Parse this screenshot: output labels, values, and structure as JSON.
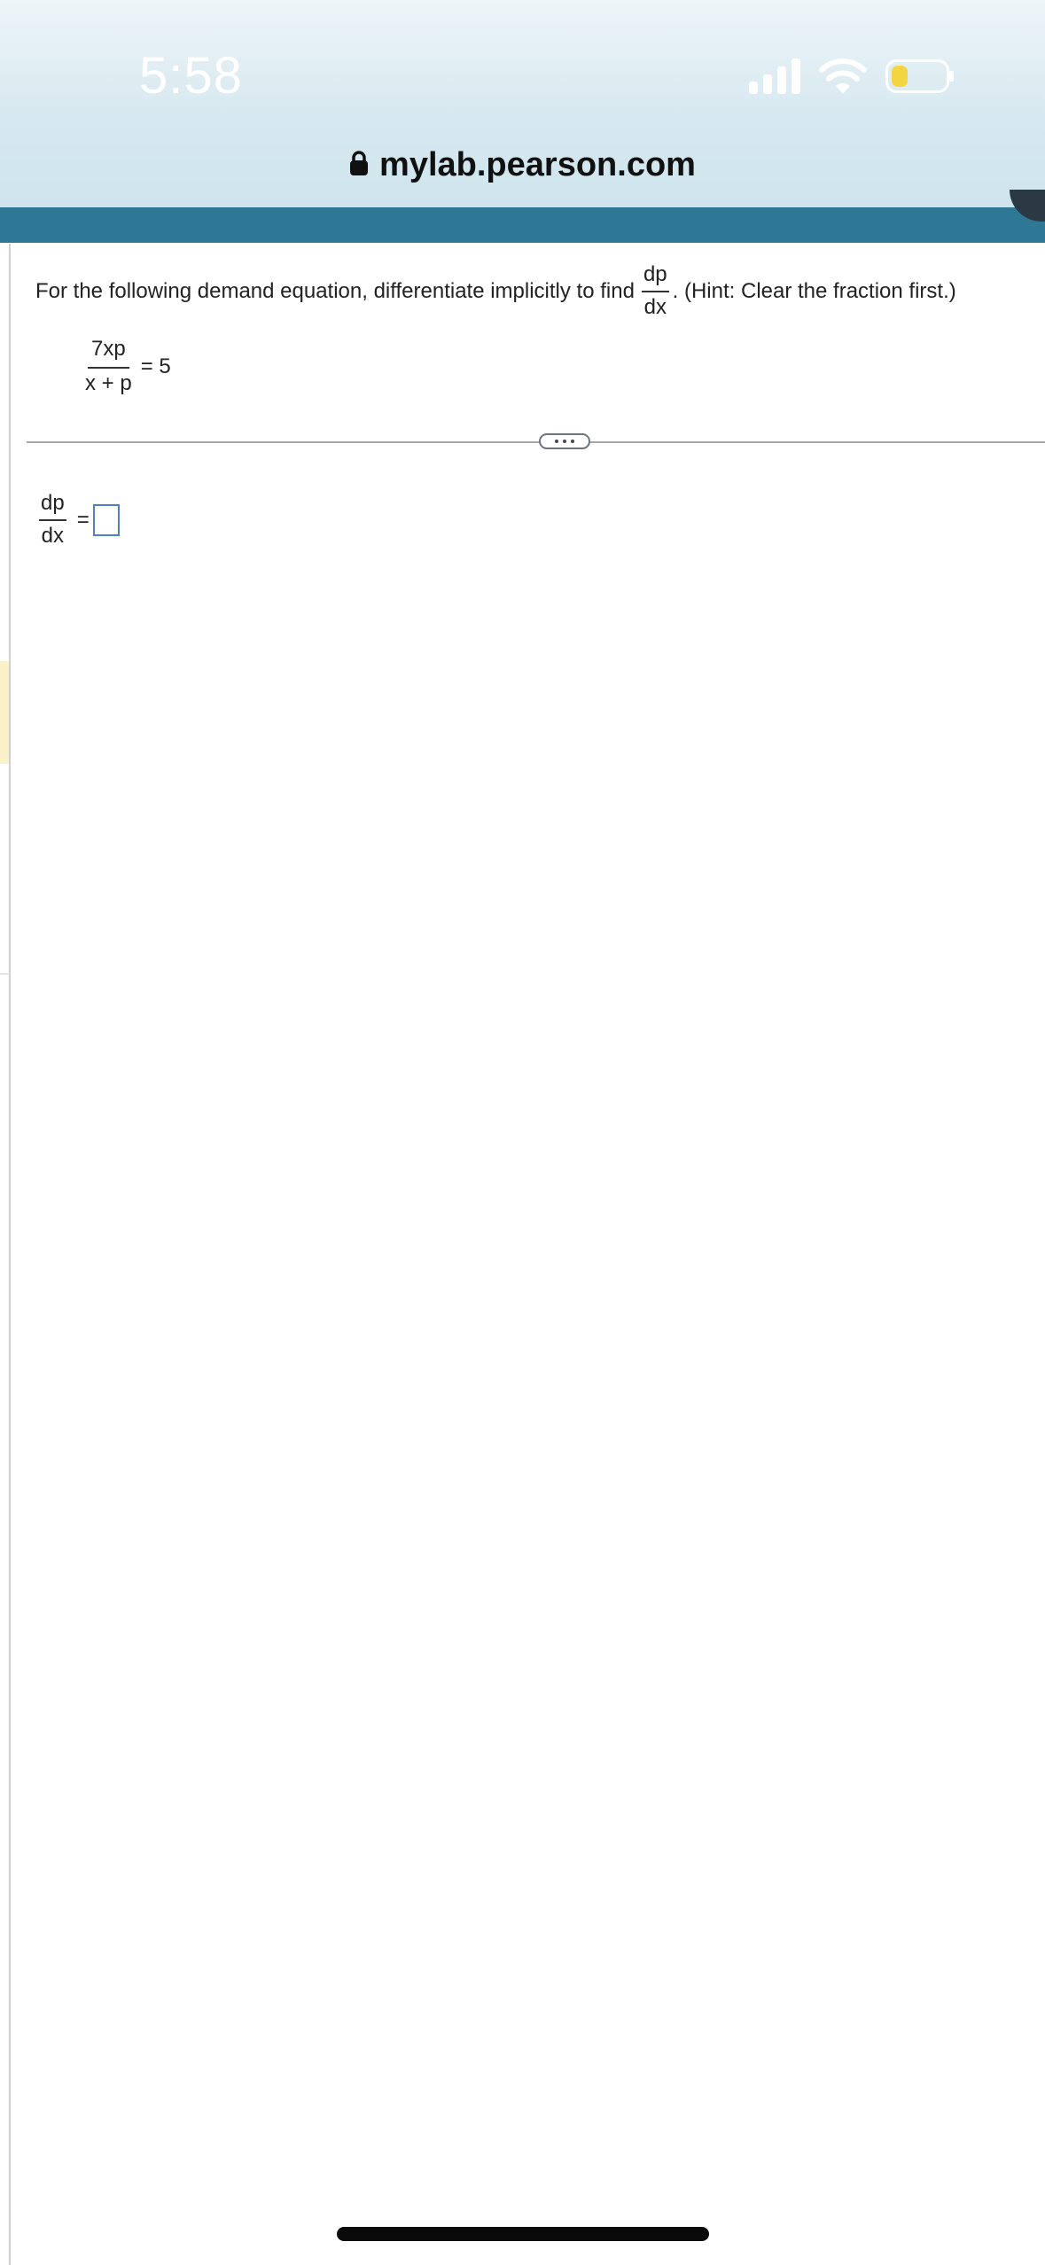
{
  "status_bar": {
    "time": "5:58",
    "signal_icon": "cellular-signal-icon",
    "wifi_icon": "wifi-icon",
    "battery_icon": "battery-low-icon",
    "battery_color": "#f5d442"
  },
  "browser": {
    "url": "mylab.pearson.com",
    "lock_icon": "lock-icon"
  },
  "header": {
    "band_color": "#2e7896"
  },
  "question": {
    "prompt": "For the following demand equation, differentiate implicitly to find",
    "derivative_num": "dp",
    "derivative_den": "dx",
    "hint": ". (Hint: Clear the fraction first.)",
    "equation": {
      "numerator": "7xp",
      "denominator": "x + p",
      "rhs": "= 5"
    }
  },
  "divider": {
    "expand_icon": "more-horizontal-icon"
  },
  "answer": {
    "lhs_num": "dp",
    "lhs_den": "dx",
    "equals": "=",
    "value": ""
  }
}
